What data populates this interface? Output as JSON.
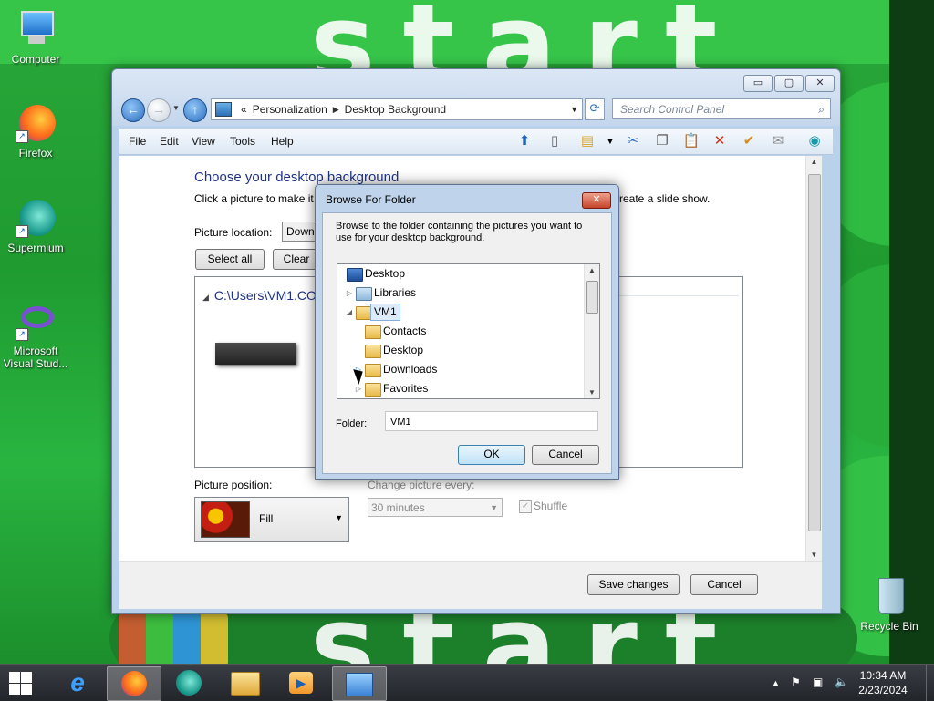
{
  "desktop": {
    "icons": [
      {
        "label": "Computer"
      },
      {
        "label": "Firefox"
      },
      {
        "label": "Supermium"
      },
      {
        "label": "Microsoft Visual Stud..."
      },
      {
        "label": "Recycle Bin"
      }
    ],
    "wallpaper_text": "start"
  },
  "window": {
    "caption_buttons": {
      "minimize": "▭",
      "maximize": "▢",
      "close": "✕"
    },
    "address": {
      "prefix": "«",
      "crumbs": [
        "Personalization",
        "Desktop Background"
      ]
    },
    "search_placeholder": "Search Control Panel",
    "menu": [
      "File",
      "Edit",
      "View",
      "Tools",
      "Help"
    ],
    "content": {
      "heading": "Choose your desktop background",
      "subtitle_left": "Click a picture to make it",
      "subtitle_right": "reate a slide show.",
      "picture_location_label": "Picture location:",
      "picture_location_value": "Down",
      "select_all": "Select all",
      "clear_all": "Clear",
      "folder_path": "C:\\Users\\VM1.CO",
      "picture_position_label": "Picture position:",
      "picture_position_value": "Fill",
      "change_picture_label": "Change picture every:",
      "change_picture_value": "30 minutes",
      "shuffle_label": "Shuffle"
    },
    "footer": {
      "save": "Save changes",
      "cancel": "Cancel"
    }
  },
  "dialog": {
    "title": "Browse For Folder",
    "close": "✕",
    "description": "Browse to the folder containing the pictures you want to use for your desktop background.",
    "tree": [
      {
        "label": "Desktop",
        "level": 0,
        "expander": "",
        "icon": "desktop"
      },
      {
        "label": "Libraries",
        "level": 1,
        "expander": "▷",
        "icon": "folder"
      },
      {
        "label": "VM1",
        "level": 1,
        "expander": "◢",
        "icon": "user-folder",
        "selected": true
      },
      {
        "label": "Contacts",
        "level": 2,
        "expander": "",
        "icon": "folder"
      },
      {
        "label": "Desktop",
        "level": 2,
        "expander": "",
        "icon": "desktop-folder"
      },
      {
        "label": "Downloads",
        "level": 2,
        "expander": "▷",
        "icon": "download-folder"
      },
      {
        "label": "Favorites",
        "level": 2,
        "expander": "▷",
        "icon": "star-folder"
      }
    ],
    "folder_label": "Folder:",
    "folder_value": "VM1",
    "ok": "OK",
    "cancel": "Cancel"
  },
  "taskbar": {
    "apps": [
      "Internet Explorer",
      "Firefox",
      "Supermium",
      "File Explorer",
      "Windows Media Player",
      "Control Panel"
    ],
    "time": "10:34 AM",
    "date": "2/23/2024"
  }
}
